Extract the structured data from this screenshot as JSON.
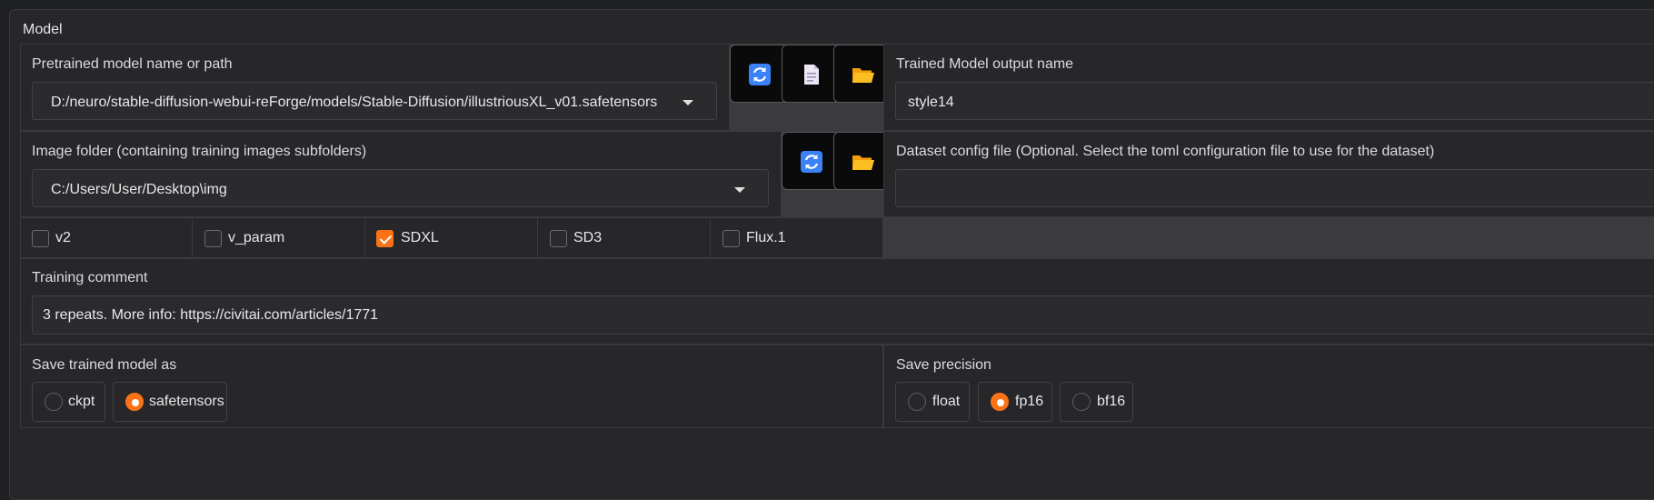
{
  "section_title": "Model",
  "pretrained": {
    "label": "Pretrained model name or path",
    "value": "D:/neuro/stable-diffusion-webui-reForge/models/Stable-Diffusion/illustriousXL_v01.safetensors"
  },
  "trained_output": {
    "label": "Trained Model output name",
    "value": "style14"
  },
  "image_folder": {
    "label": "Image folder (containing training images subfolders)",
    "value": "C:/Users/User/Desktop\\img"
  },
  "dataset_config": {
    "label": "Dataset config file (Optional. Select the toml configuration file to use for the dataset)",
    "value": ""
  },
  "checkboxes": [
    {
      "label": "v2",
      "checked": false
    },
    {
      "label": "v_param",
      "checked": false
    },
    {
      "label": "SDXL",
      "checked": true
    },
    {
      "label": "SD3",
      "checked": false
    },
    {
      "label": "Flux.1",
      "checked": false
    }
  ],
  "training_comment": {
    "label": "Training comment",
    "value": "3 repeats. More info: https://civitai.com/articles/1771"
  },
  "save_model_as": {
    "label": "Save trained model as",
    "options": [
      "ckpt",
      "safetensors"
    ],
    "selected": "safetensors"
  },
  "save_precision": {
    "label": "Save precision",
    "options": [
      "float",
      "fp16",
      "bf16"
    ],
    "selected": "fp16"
  },
  "icons": {
    "refresh": "refresh-icon",
    "document": "document-icon",
    "folder": "folder-icon"
  },
  "colors": {
    "accent": "#f97316",
    "background": "#1f2023",
    "panel": "#27272a"
  }
}
